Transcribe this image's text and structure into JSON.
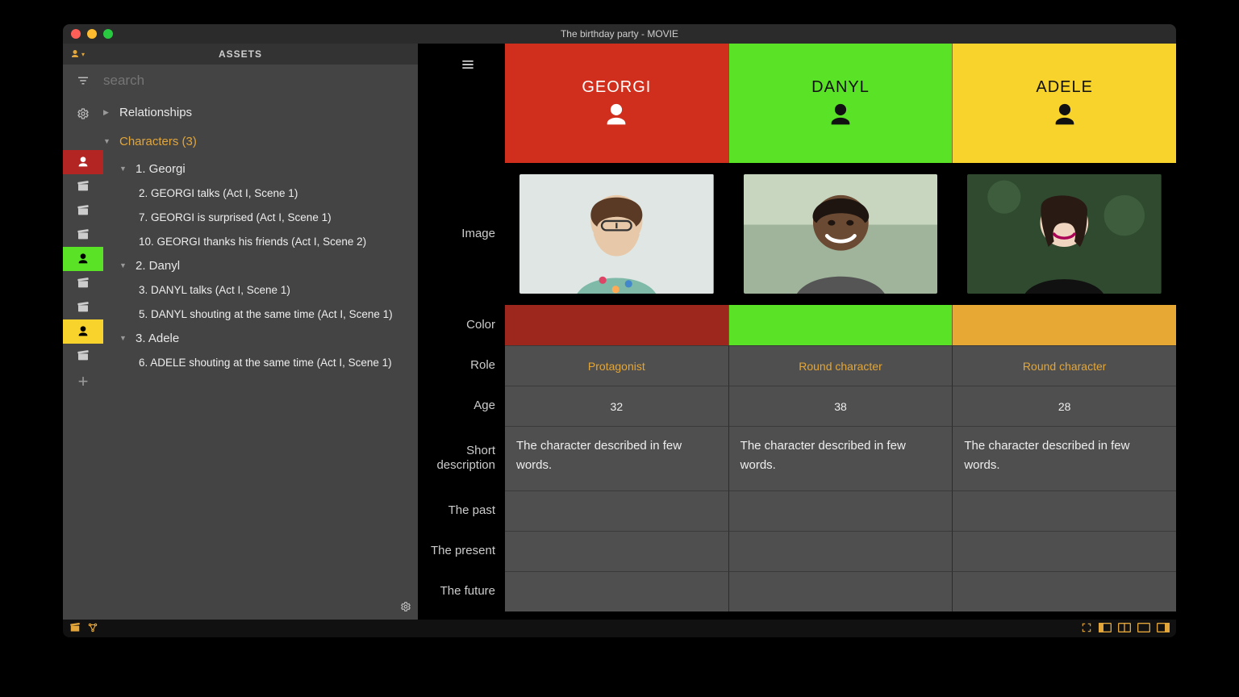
{
  "window": {
    "title": "The birthday party - MOVIE"
  },
  "assets_header": {
    "title": "ASSETS"
  },
  "search": {
    "placeholder": "search"
  },
  "tree": {
    "relationships_label": "Relationships",
    "characters_label": "Characters (3)",
    "characters": [
      {
        "label": "1. Georgi",
        "badge_color": "#b22523",
        "events": [
          "2. GEORGI talks (Act I, Scene 1)",
          "7. GEORGI is surprised (Act I, Scene 1)",
          "10. GEORGI thanks his friends (Act I, Scene 2)"
        ]
      },
      {
        "label": "2. Danyl",
        "badge_color": "#5ae227",
        "events": [
          "3. DANYL talks (Act I, Scene 1)",
          "5. DANYL shouting at the same time (Act I, Scene 1)"
        ]
      },
      {
        "label": "3. Adele",
        "badge_color": "#f7d32b",
        "events": [
          "6. ADELE shouting at the same time (Act I, Scene 1)"
        ]
      }
    ]
  },
  "detail": {
    "row_labels": {
      "image": "Image",
      "color": "Color",
      "role": "Role",
      "age": "Age",
      "short_desc": "Short\ndescription",
      "past": "The past",
      "present": "The present",
      "future": "The future"
    },
    "characters": [
      {
        "name": "GEORGI",
        "color": "#9d271c",
        "role": "Protagonist",
        "age": "32",
        "short_desc": "The character described in few words."
      },
      {
        "name": "DANYL",
        "color": "#5ae227",
        "role": "Round character",
        "age": "38",
        "short_desc": "The character described in few words."
      },
      {
        "name": "ADELE",
        "color": "#e7a834",
        "role": "Round character",
        "age": "28",
        "short_desc": "The character described in few words."
      }
    ]
  }
}
